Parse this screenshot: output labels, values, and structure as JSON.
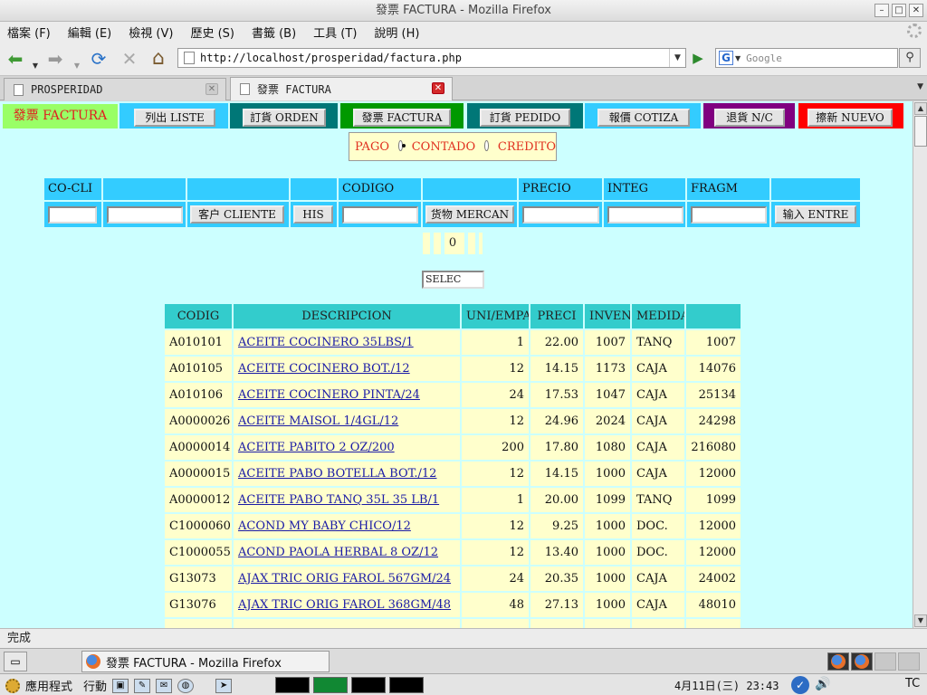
{
  "window": {
    "title": "發票 FACTURA - Mozilla Firefox"
  },
  "menu": [
    "檔案 (F)",
    "編輯 (E)",
    "檢視 (V)",
    "歷史 (S)",
    "書籤 (B)",
    "工具 (T)",
    "說明 (H)"
  ],
  "nav": {
    "url": "http://localhost/prosperidad/factura.php",
    "search_placeholder": "Google"
  },
  "tabs": [
    {
      "label": "PROSPERIDAD",
      "active": false
    },
    {
      "label": "發票 FACTURA",
      "active": true
    }
  ],
  "page": {
    "brand": "發票 FACTURA",
    "topnav": [
      {
        "label": "列出 LISTE",
        "bg": "#33ccff"
      },
      {
        "label": "訂貨 ORDEN",
        "bg": "#007777"
      },
      {
        "label": "發票 FACTURA",
        "bg": "#009900"
      },
      {
        "label": "訂貨 PEDIDO",
        "bg": "#007777"
      },
      {
        "label": "報價 COTIZA",
        "bg": "#33ccff"
      },
      {
        "label": "退貨 N/C",
        "bg": "#800080"
      },
      {
        "label": "擦新 NUEVO",
        "bg": "#ff0000"
      }
    ],
    "pago": {
      "label": "PAGO",
      "options": [
        "CONTADO",
        "CREDITO"
      ],
      "selected": "CONTADO"
    },
    "form_headers": [
      "CO-CLI",
      "",
      "",
      "",
      "CODIGO",
      "",
      "PRECIO",
      "INTEG",
      "FRAGM",
      ""
    ],
    "form_buttons": {
      "cliente": "客户 CLIENTE",
      "his": "HIS",
      "mercan": "货物 MERCAN",
      "entre": "输入 ENTRE"
    },
    "counter": "0",
    "selec": "SELEC",
    "table": {
      "headers": [
        "CODIG",
        "DESCRIPCION",
        "UNI/EMPA",
        "PRECI",
        "INVEN",
        "MEDIDA",
        ""
      ],
      "rows": [
        [
          "A010101",
          "ACEITE COCINERO 35LBS/1",
          "1",
          "22.00",
          "1007",
          "TANQ",
          "1007"
        ],
        [
          "A010105",
          "ACEITE COCINERO BOT./12",
          "12",
          "14.15",
          "1173",
          "CAJA",
          "14076"
        ],
        [
          "A010106",
          "ACEITE COCINERO PINTA/24",
          "24",
          "17.53",
          "1047",
          "CAJA",
          "25134"
        ],
        [
          "A0000026",
          "ACEITE MAISOL 1/4GL/12",
          "12",
          "24.96",
          "2024",
          "CAJA",
          "24298"
        ],
        [
          "A0000014",
          "ACEITE PABITO 2 OZ/200",
          "200",
          "17.80",
          "1080",
          "CAJA",
          "216080"
        ],
        [
          "A0000015",
          "ACEITE PABO BOTELLA BOT./12",
          "12",
          "14.15",
          "1000",
          "CAJA",
          "12000"
        ],
        [
          "A0000012",
          "ACEITE PABO TANQ 35L 35 LB/1",
          "1",
          "20.00",
          "1099",
          "TANQ",
          "1099"
        ],
        [
          "C1000060",
          "ACOND MY BABY CHICO/12",
          "12",
          "9.25",
          "1000",
          "DOC.",
          "12000"
        ],
        [
          "C1000055",
          "ACOND PAOLA HERBAL 8 OZ/12",
          "12",
          "13.40",
          "1000",
          "DOC.",
          "12000"
        ],
        [
          "G13073",
          "AJAX TRIC ORIG FAROL 567GM/24",
          "24",
          "20.35",
          "1000",
          "CAJA",
          "24002"
        ],
        [
          "G13076",
          "AJAX TRIC ORIG FAROL 368GM/48",
          "48",
          "27.13",
          "1000",
          "CAJA",
          "48010"
        ]
      ]
    }
  },
  "status": "完成",
  "taskbar": {
    "item": "發票 FACTURA - Mozilla Firefox"
  },
  "panel": {
    "apps": "應用程式",
    "actions": "行動",
    "clock": "4月11日(三) 23:43",
    "tc": "TC"
  }
}
